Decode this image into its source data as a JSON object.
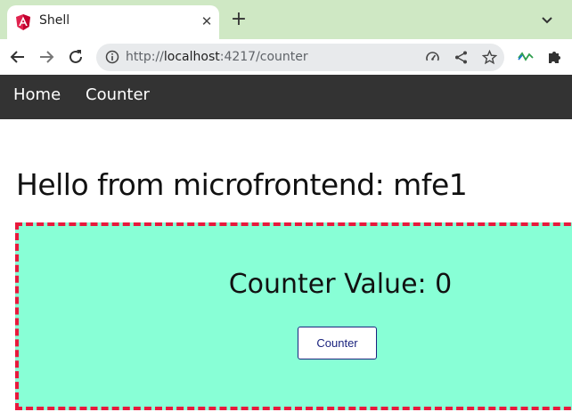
{
  "browser": {
    "tab_title": "Shell",
    "tab_close": "✕",
    "new_tab": "+",
    "url_scheme": "http://",
    "url_host": "localhost",
    "url_rest": ":4217/counter"
  },
  "navbar": {
    "items": [
      {
        "label": "Home"
      },
      {
        "label": "Counter"
      }
    ]
  },
  "main": {
    "heading": "Hello from microfrontend: mfe1",
    "counter_label": "Counter Value: 0",
    "counter_button": "Counter"
  },
  "colors": {
    "tab_strip": "#cfe8c4",
    "navbar": "#333333",
    "mfe_background": "#88ffd6",
    "mfe_border": "#e8193c",
    "button_text": "#1a237e"
  },
  "icons": {
    "favicon": "angular-icon",
    "back": "arrow-left-icon",
    "forward": "arrow-right-icon",
    "reload": "reload-icon",
    "site_info": "info-icon",
    "performance": "speedometer-icon",
    "share": "share-icon",
    "bookmark": "star-icon",
    "extension_activity": "activity-icon",
    "extensions": "puzzle-icon",
    "tab_search": "chevron-down-icon"
  }
}
